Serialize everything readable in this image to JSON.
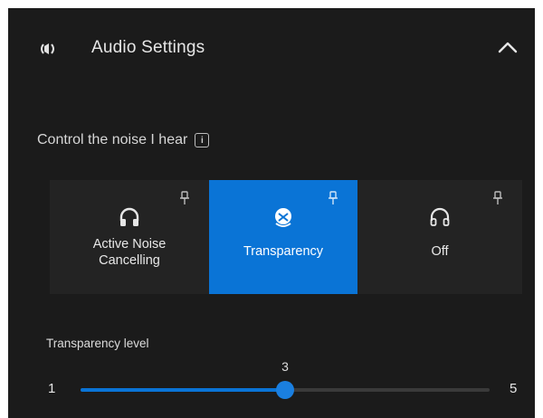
{
  "header": {
    "title": "Audio Settings",
    "icon": "speaker-icon",
    "collapse_icon": "chevron-up-icon"
  },
  "noise_control": {
    "label": "Control the noise I hear",
    "info_icon": "info-icon",
    "selected": "Transparency",
    "modes": [
      {
        "label": "Active Noise Cancelling",
        "icon": "headphones-icon",
        "pin_icon": "pin-icon"
      },
      {
        "label": "Transparency",
        "icon": "transparency-icon",
        "pin_icon": "pin-icon"
      },
      {
        "label": "Off",
        "icon": "headphones-outline-icon",
        "pin_icon": "pin-icon"
      }
    ]
  },
  "transparency_level": {
    "label": "Transparency level",
    "min": 1,
    "max": 5,
    "value": 3,
    "min_label": "1",
    "max_label": "5",
    "value_label": "3"
  },
  "colors": {
    "background": "#1b1b1b",
    "accent": "#0a74d6",
    "tile": "#232323",
    "text": "#e8e8e8"
  }
}
